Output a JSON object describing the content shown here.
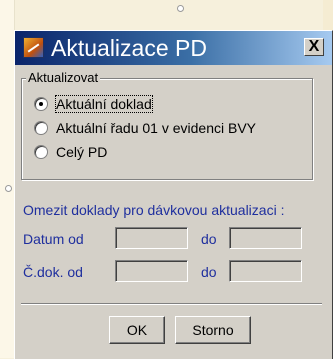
{
  "dialog": {
    "title": "Aktualizace PD",
    "close_label": "X"
  },
  "update_group": {
    "legend": "Aktualizovat",
    "options": [
      {
        "label": "Aktuální doklad",
        "checked": true
      },
      {
        "label": "Aktuální řadu 01 v evidenci BVY",
        "checked": false
      },
      {
        "label": "Celý PD",
        "checked": false
      }
    ]
  },
  "limit": {
    "title": "Omezit doklady pro dávkovou aktualizaci :",
    "date_from_label": "Datum od",
    "date_from_value": "",
    "date_to_label": "do",
    "date_to_value": "",
    "doc_from_label": "Č.dok. od",
    "doc_from_value": "",
    "doc_to_label": "do",
    "doc_to_value": ""
  },
  "buttons": {
    "ok": "OK",
    "cancel": "Storno"
  },
  "colors": {
    "titlebar_start": "#0a246a",
    "titlebar_end": "#a6caf0",
    "dialog_bg": "#d4d0c8",
    "label_blue": "#1f2f9e"
  }
}
